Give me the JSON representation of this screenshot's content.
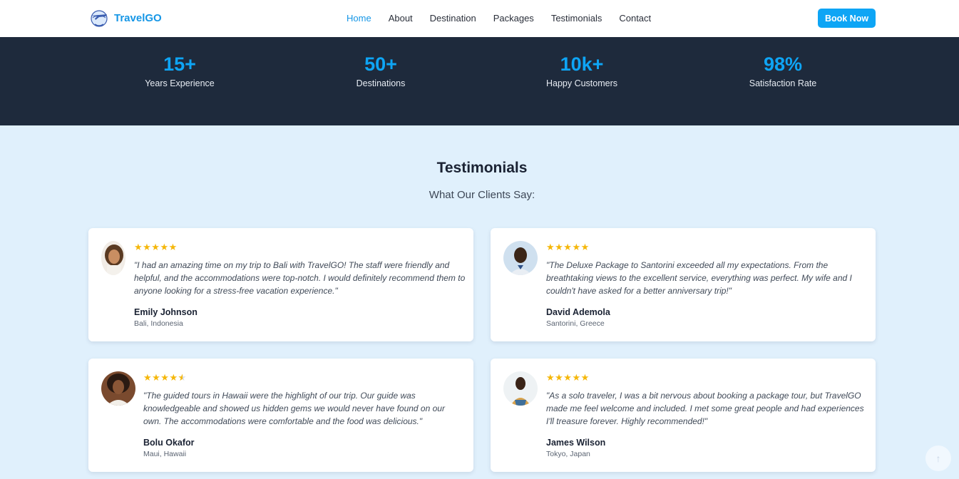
{
  "nav": {
    "brand": "TravelGO",
    "links": [
      "Home",
      "About",
      "Destination",
      "Packages",
      "Testimonials",
      "Contact"
    ],
    "active": "Home",
    "cta": "Book Now"
  },
  "stats": [
    {
      "value": "15+",
      "label": "Years Experience"
    },
    {
      "value": "50+",
      "label": "Destinations"
    },
    {
      "value": "10k+",
      "label": "Happy Customers"
    },
    {
      "value": "98%",
      "label": "Satisfaction Rate"
    }
  ],
  "testimonials": {
    "title": "Testimonials",
    "subtitle": "What Our Clients Say:",
    "items": [
      {
        "rating": 5,
        "quote": "\"I had an amazing time on my trip to Bali with TravelGO! The staff were friendly and helpful, and the accommodations were top-notch. I would definitely recommend them to anyone looking for a stress-free vacation experience.\"",
        "name": "Emily Johnson",
        "location": "Bali, Indonesia"
      },
      {
        "rating": 5,
        "quote": "\"The Deluxe Package to Santorini exceeded all my expectations. From the breathtaking views to the excellent service, everything was perfect. My wife and I couldn't have asked for a better anniversary trip!\"",
        "name": "David Ademola",
        "location": "Santorini, Greece"
      },
      {
        "rating": 4.5,
        "quote": "\"The guided tours in Hawaii were the highlight of our trip. Our guide was knowledgeable and showed us hidden gems we would never have found on our own. The accommodations were comfortable and the food was delicious.\"",
        "name": "Bolu Okafor",
        "location": "Maui, Hawaii"
      },
      {
        "rating": 5,
        "quote": "\"As a solo traveler, I was a bit nervous about booking a package tour, but TravelGO made me feel welcome and included. I met some great people and had experiences I'll treasure forever. Highly recommended!\"",
        "name": "James Wilson",
        "location": "Tokyo, Japan"
      }
    ]
  },
  "colors": {
    "accent": "#0ea5f5",
    "dark_band": "#1e2a3c",
    "section_bg": "#e0f0fc",
    "star": "#f5b70a"
  },
  "icons": {
    "logo": "airplane-globe-logo",
    "scroll_top": "arrow-up-icon"
  }
}
